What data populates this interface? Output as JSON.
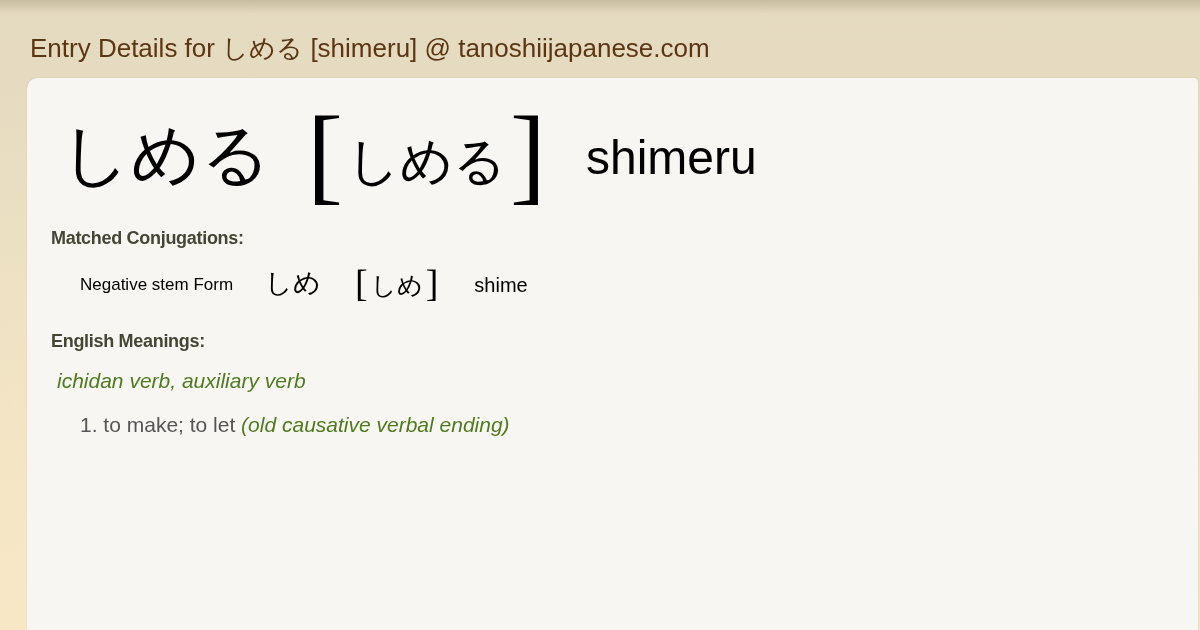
{
  "page_title": "Entry Details for しめる [shimeru] @ tanoshiijapanese.com",
  "entry": {
    "word": "しめる",
    "reading": {
      "open_bracket": "[",
      "text": "しめる",
      "close_bracket": "]"
    },
    "romaji": "shimeru"
  },
  "conjugations": {
    "heading": "Matched Conjugations:",
    "items": [
      {
        "form": "Negative stem Form",
        "word": "しめ",
        "reading": {
          "open_bracket": "[",
          "text": "しめ",
          "close_bracket": "]"
        },
        "romaji": "shime"
      }
    ]
  },
  "meanings": {
    "heading": "English Meanings:",
    "part_of_speech": "ichidan verb, auxiliary verb",
    "senses": [
      {
        "number": "1.",
        "gloss": "to make; to let",
        "note": "(old causative verbal ending)"
      }
    ]
  }
}
